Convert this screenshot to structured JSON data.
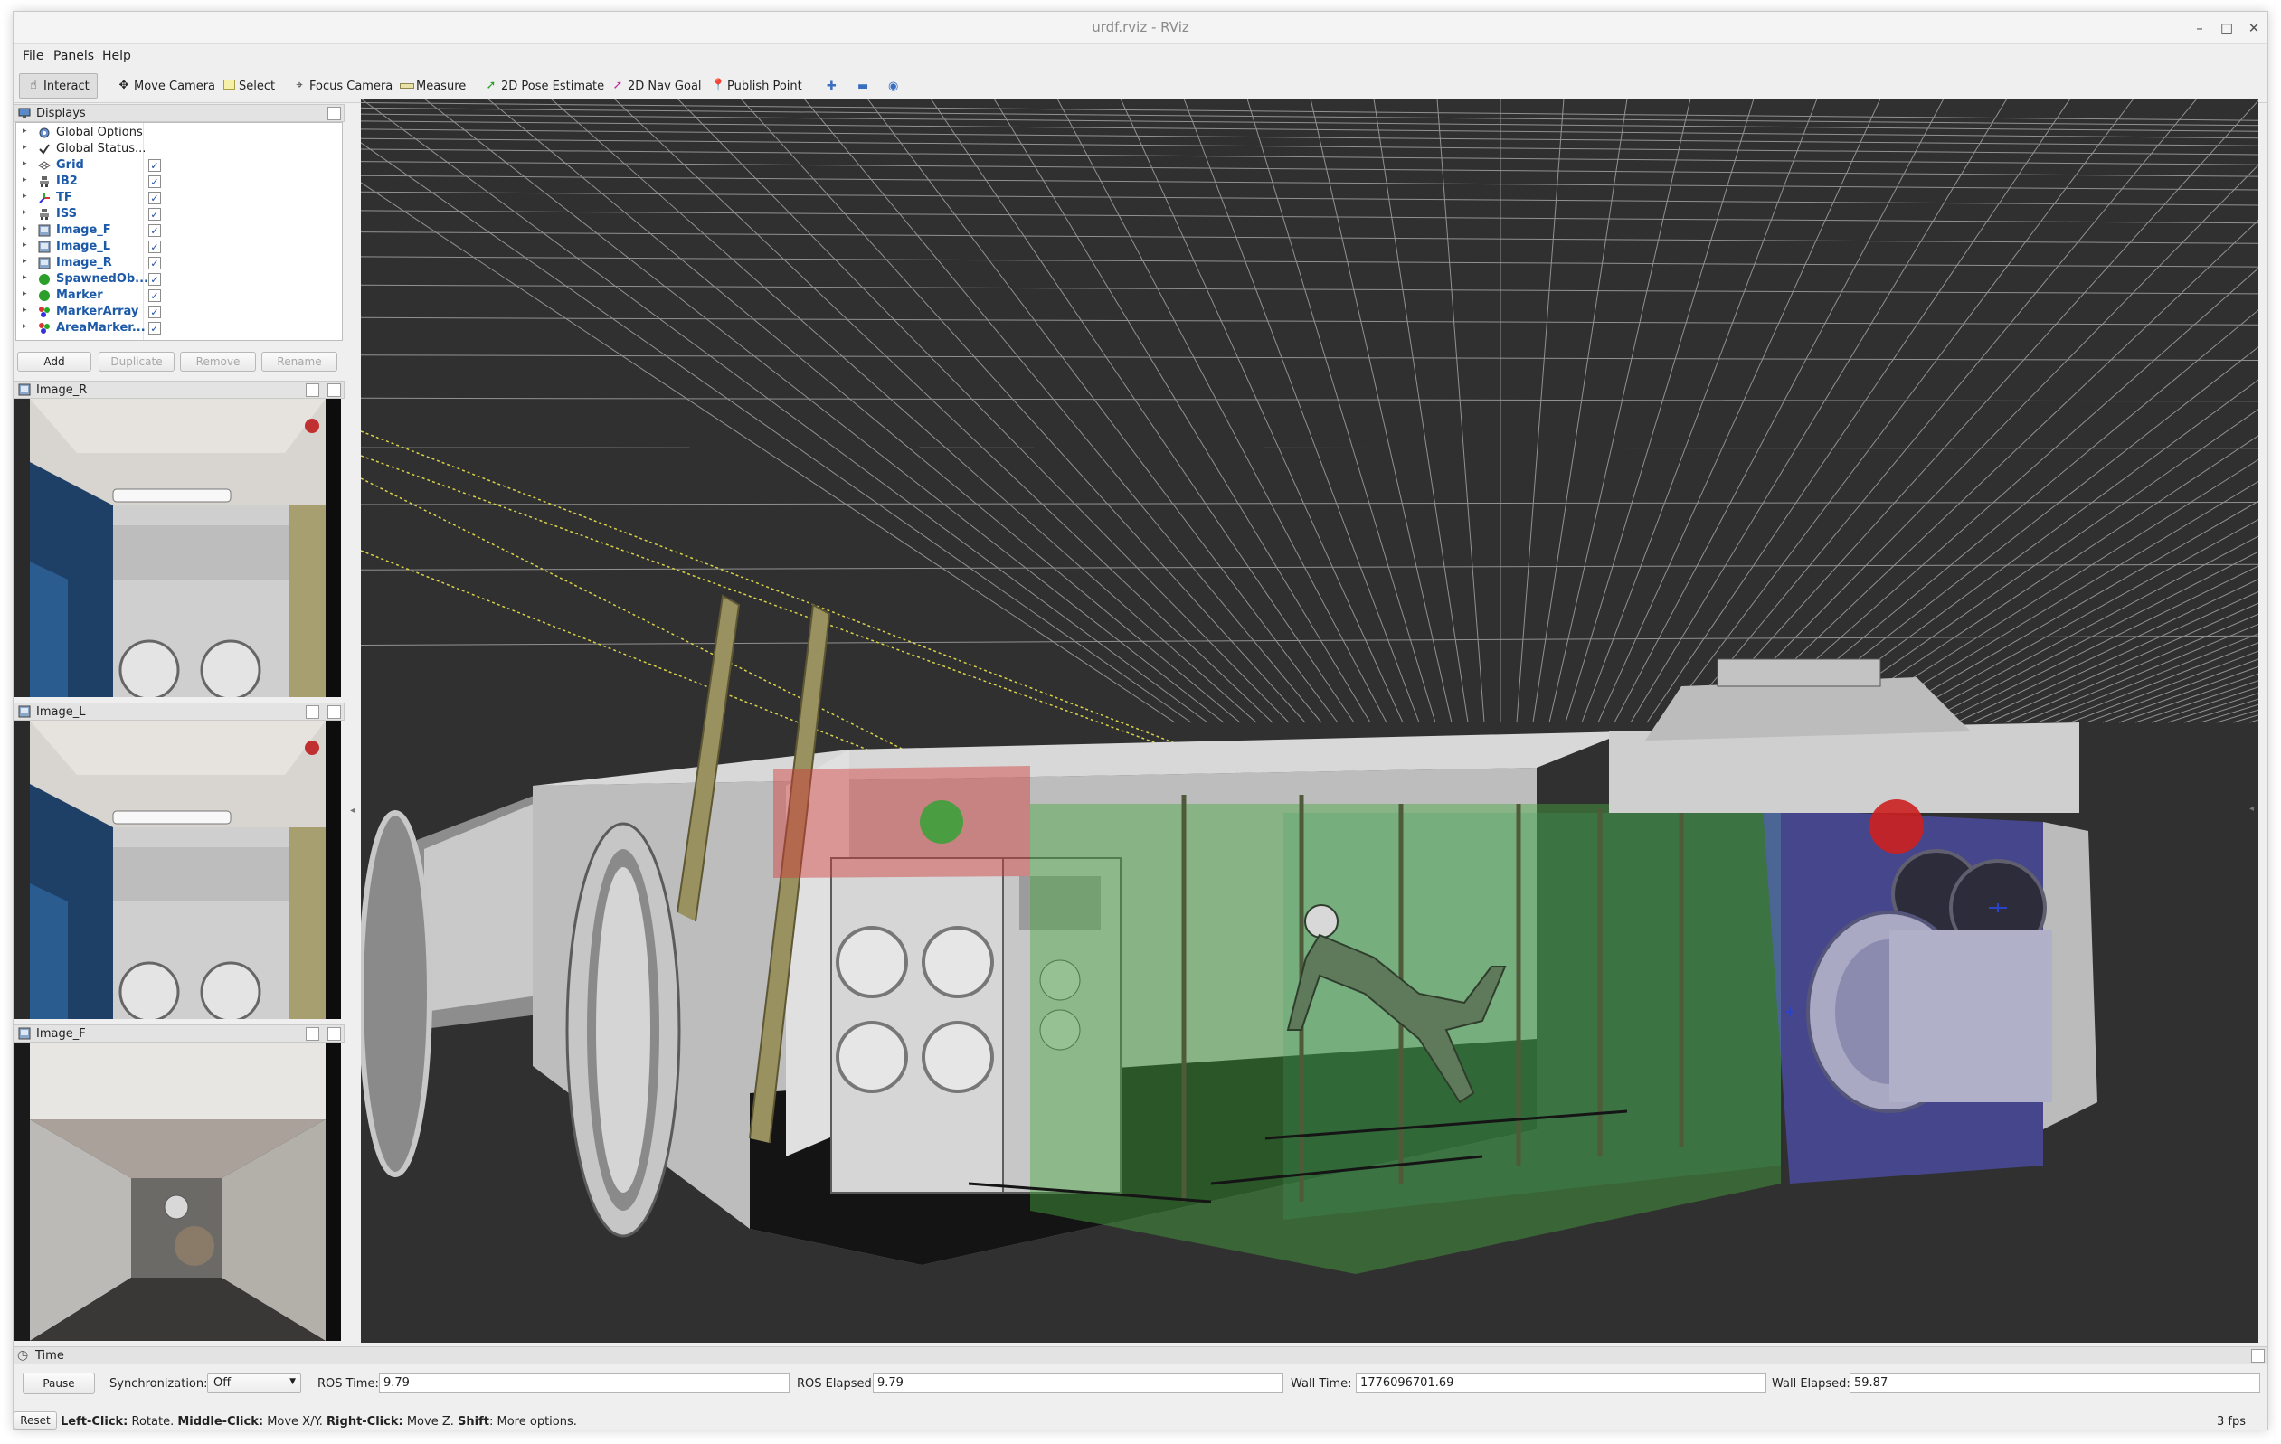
{
  "window": {
    "title": "urdf.rviz - RViz",
    "controls": {
      "minimize": "–",
      "maximize": "□",
      "close": "✕"
    }
  },
  "menu": [
    "File",
    "Panels",
    "Help"
  ],
  "toolbar": {
    "tools": [
      {
        "label": "Interact",
        "icon": "hand-icon",
        "active": true
      },
      {
        "label": "Move Camera",
        "icon": "move-camera-icon",
        "active": false
      },
      {
        "label": "Select",
        "icon": "select-icon",
        "active": false
      },
      {
        "label": "Focus Camera",
        "icon": "focus-camera-icon",
        "active": false
      },
      {
        "label": "Measure",
        "icon": "ruler-icon",
        "active": false
      },
      {
        "label": "2D Pose Estimate",
        "icon": "pose-arrow-icon",
        "active": false
      },
      {
        "label": "2D Nav Goal",
        "icon": "nav-goal-icon",
        "active": false
      },
      {
        "label": "Publish Point",
        "icon": "pin-icon",
        "active": false
      }
    ],
    "extra_icons": [
      "add-tool-icon",
      "remove-tool-icon",
      "view-icon"
    ]
  },
  "displays": {
    "title": "Displays",
    "items": [
      {
        "label": "Global Options",
        "icon": "gear-icon",
        "checkbox": false,
        "bold": false
      },
      {
        "label": "Global Status...",
        "icon": "check-icon",
        "checkbox": false,
        "bold": false
      },
      {
        "label": "Grid",
        "icon": "grid-icon",
        "checkbox": true,
        "bold": true
      },
      {
        "label": "IB2",
        "icon": "robot-model-icon",
        "checkbox": true,
        "bold": true
      },
      {
        "label": "TF",
        "icon": "tf-icon",
        "checkbox": true,
        "bold": true
      },
      {
        "label": "ISS",
        "icon": "robot-model-icon",
        "checkbox": true,
        "bold": true
      },
      {
        "label": "Image_F",
        "icon": "image-icon",
        "checkbox": true,
        "bold": true
      },
      {
        "label": "Image_L",
        "icon": "image-icon",
        "checkbox": true,
        "bold": true
      },
      {
        "label": "Image_R",
        "icon": "image-icon",
        "checkbox": true,
        "bold": true
      },
      {
        "label": "SpawnedOb...",
        "icon": "marker-green-icon",
        "checkbox": true,
        "bold": true
      },
      {
        "label": "Marker",
        "icon": "marker-green-icon",
        "checkbox": true,
        "bold": true
      },
      {
        "label": "MarkerArray",
        "icon": "marker-array-icon",
        "checkbox": true,
        "bold": true
      },
      {
        "label": "AreaMarker...",
        "icon": "marker-array-icon",
        "checkbox": true,
        "bold": true
      }
    ],
    "check_glyph": "✓",
    "buttons": {
      "add": "Add",
      "duplicate": "Duplicate",
      "remove": "Remove",
      "rename": "Rename"
    }
  },
  "image_panels": [
    {
      "title": "Image_R"
    },
    {
      "title": "Image_L"
    },
    {
      "title": "Image_F"
    }
  ],
  "time": {
    "title": "Time",
    "pause": "Pause",
    "sync_label": "Synchronization:",
    "sync_value": "Off",
    "ros_time_label": "ROS Time:",
    "ros_time": "9.79",
    "ros_elapsed_label": "ROS Elapsed:",
    "ros_elapsed": "9.79",
    "wall_time_label": "Wall Time:",
    "wall_time": "1776096701.69",
    "wall_elapsed_label": "Wall Elapsed:",
    "wall_elapsed": "59.87"
  },
  "status": {
    "reset": "Reset",
    "left_click": "Left-Click:",
    "left_click_desc": "Rotate.",
    "middle_click": "Middle-Click:",
    "middle_click_desc": "Move X/Y.",
    "right_click": "Right-Click:",
    "right_click_desc": "Move Z.",
    "shift": "Shift",
    "shift_desc": "More options.",
    "fps": "3 fps"
  },
  "colors": {
    "viewport_bg": "#303030",
    "grid": "#a9a9a9",
    "selection_red": "#d23a3a",
    "selection_green": "#3fa33a",
    "selection_blue": "#5a5ad8",
    "link_blue": "#1c5aa8"
  }
}
